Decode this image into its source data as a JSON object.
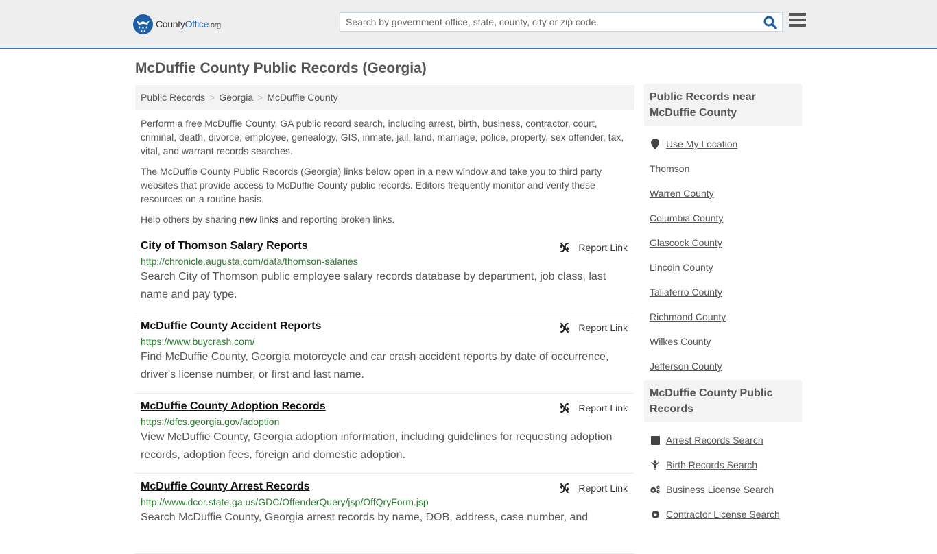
{
  "header": {
    "logo": {
      "part1": "County",
      "part2": "Office",
      "part3": ".org"
    },
    "search": {
      "placeholder": "Search by government office, state, county, city or zip code",
      "value": ""
    },
    "colors": {
      "brand": "#1d5fa6",
      "header_bg": "#eeeeee",
      "header_border": "#3f78a8"
    }
  },
  "page": {
    "title": "McDuffie County Public Records (Georgia)",
    "breadcrumb": [
      "Public Records",
      "Georgia",
      "McDuffie County"
    ],
    "intro": {
      "p1": "Perform a free McDuffie County, GA public record search, including arrest, birth, business, contractor, court, criminal, death, divorce, employee, genealogy, GIS, inmate, jail, land, marriage, police, property, sex offender, tax, vital, and warrant records searches.",
      "p2": "The McDuffie County Public Records (Georgia) links below open in a new window and take you to third party websites that provide access to McDuffie County public records. Editors frequently monitor and verify these resources on a routine basis.",
      "p3_before": "Help others by sharing ",
      "p3_link": "new links",
      "p3_after": " and reporting broken links."
    }
  },
  "records": [
    {
      "title": "City of Thomson Salary Reports",
      "url": "http://chronicle.augusta.com/data/thomson-salaries",
      "description": "Search City of Thomson public employee salary records database by department, job class, last name and pay type.",
      "report_label": "Report Link"
    },
    {
      "title": "McDuffie County Accident Reports",
      "url": "https://www.buycrash.com/",
      "description": "Find McDuffie County, Georgia motorcycle and car crash accident reports by date of occurrence, driver's license number, or first and last name.",
      "report_label": "Report Link"
    },
    {
      "title": "McDuffie County Adoption Records",
      "url": "https://dfcs.georgia.gov/adoption",
      "description": "View McDuffie County, Georgia adoption information, including guidelines for requesting adoption records, adoption fees, foreign and domestic adoption.",
      "report_label": "Report Link"
    },
    {
      "title": "McDuffie County Arrest Records",
      "url": "http://www.dcor.state.ga.us/GDC/OffenderQuery/jsp/OffQryForm.jsp",
      "description": "Search McDuffie County, Georgia arrest records by name, DOB, address, case number, and",
      "report_label": "Report Link"
    }
  ],
  "sidebar": {
    "nearby": {
      "heading": "Public Records near McDuffie County",
      "use_location": "Use My Location",
      "items": [
        "Thomson",
        "Warren County",
        "Columbia County",
        "Glascock County",
        "Lincoln County",
        "Taliaferro County",
        "Richmond County",
        "Wilkes County",
        "Jefferson County"
      ]
    },
    "categories": {
      "heading": "McDuffie County Public Records",
      "items": [
        {
          "label": "Arrest Records Search",
          "icon": "square-icon"
        },
        {
          "label": "Birth Records Search",
          "icon": "child-icon"
        },
        {
          "label": "Business License Search",
          "icon": "cogs-icon"
        },
        {
          "label": "Contractor License Search",
          "icon": "gear-icon"
        }
      ]
    }
  }
}
